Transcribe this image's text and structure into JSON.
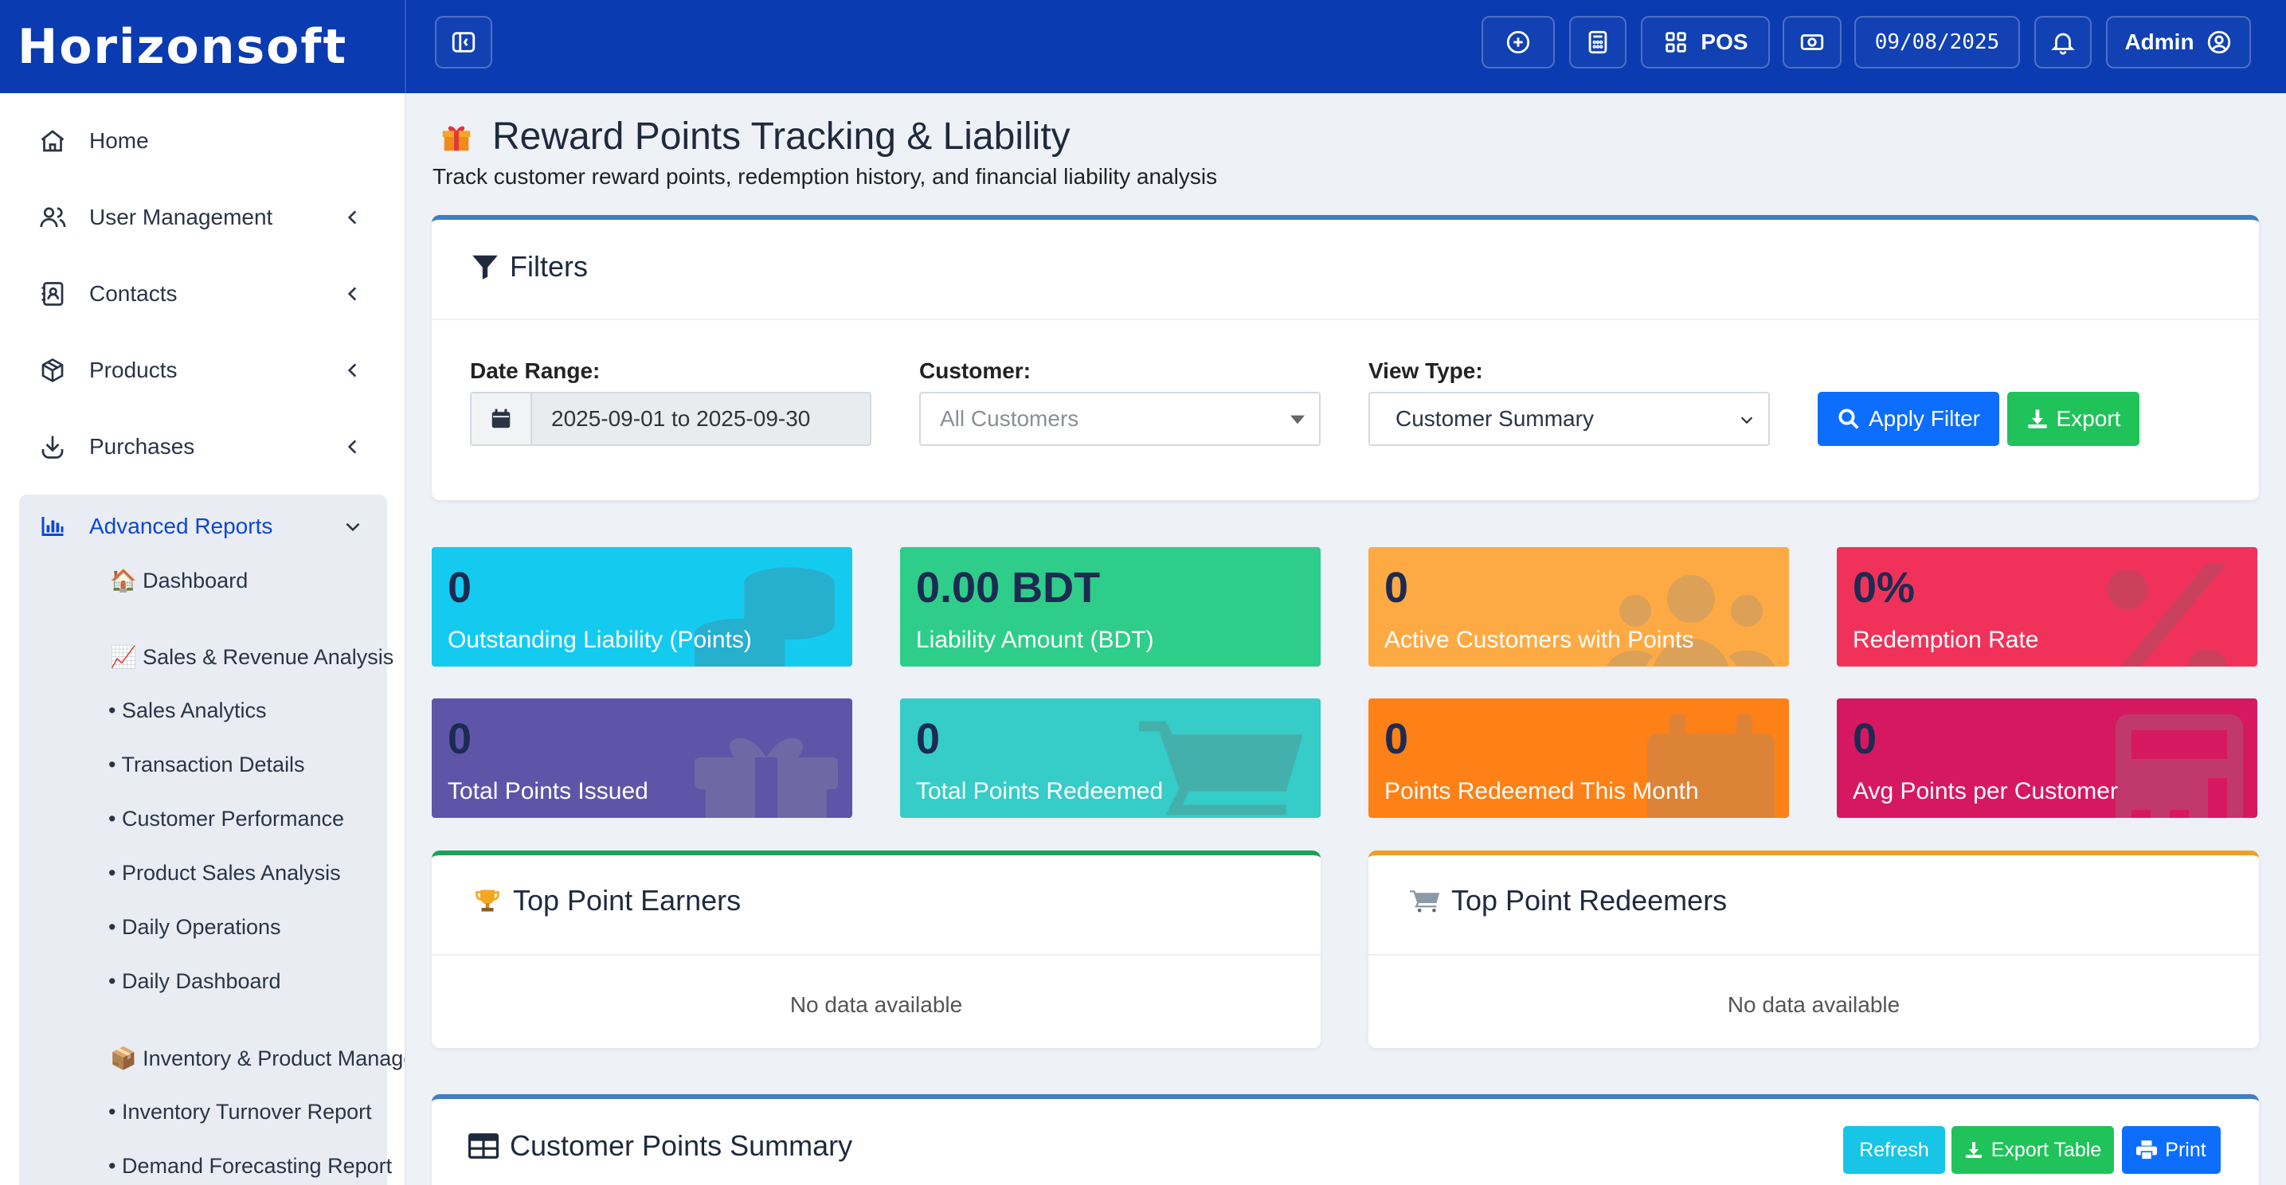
{
  "app": {
    "brand": "Horizonsoft"
  },
  "topbar": {
    "pos_label": "POS",
    "date": "09/08/2025",
    "user": "Admin"
  },
  "sidebar": {
    "items": [
      {
        "label": "Home",
        "icon": "home-icon"
      },
      {
        "label": "User Management",
        "icon": "users-icon"
      },
      {
        "label": "Contacts",
        "icon": "contacts-icon"
      },
      {
        "label": "Products",
        "icon": "box-icon"
      },
      {
        "label": "Purchases",
        "icon": "download-icon"
      }
    ],
    "active_group": "Advanced Reports",
    "sub_items": [
      "🏠 Dashboard",
      "📈 Sales & Revenue Analysis",
      "• Sales Analytics",
      "• Transaction Details",
      "• Customer Performance",
      "• Product Sales Analysis",
      "• Daily Operations",
      "• Daily Dashboard",
      "📦 Inventory & Product Management",
      "• Inventory Turnover Report",
      "• Demand Forecasting Report"
    ]
  },
  "page": {
    "title": "Reward Points Tracking & Liability",
    "subtitle": "Track customer reward points, redemption history, and financial liability analysis"
  },
  "filters": {
    "title": "Filters",
    "date_label": "Date Range:",
    "date_value": "2025-09-01 to 2025-09-30",
    "customer_label": "Customer:",
    "customer_placeholder": "All Customers",
    "view_label": "View Type:",
    "view_value": "Customer Summary",
    "apply_label": "Apply Filter",
    "export_label": "Export"
  },
  "stats": [
    {
      "value": "0",
      "label": "Outstanding Liability (Points)",
      "color": "#14cbef"
    },
    {
      "value": "0.00 BDT",
      "label": "Liability Amount (BDT)",
      "color": "#2fcd8a"
    },
    {
      "value": "0",
      "label": "Active Customers with Points",
      "color": "#fdaa45"
    },
    {
      "value": "0%",
      "label": "Redemption Rate",
      "color": "#f0325a"
    },
    {
      "value": "0",
      "label": "Total Points Issued",
      "color": "#5e55a8"
    },
    {
      "value": "0",
      "label": "Total Points Redeemed",
      "color": "#36ccc7"
    },
    {
      "value": "0",
      "label": "Points Redeemed This Month",
      "color": "#fd8117"
    },
    {
      "value": "0",
      "label": "Avg Points per Customer",
      "color": "#d61862"
    }
  ],
  "panels": {
    "earners_title": "Top Point Earners",
    "redeemers_title": "Top Point Redeemers",
    "empty_text": "No data available"
  },
  "summary": {
    "title": "Customer Points Summary",
    "refresh_label": "Refresh",
    "export_table_label": "Export Table",
    "print_label": "Print"
  }
}
